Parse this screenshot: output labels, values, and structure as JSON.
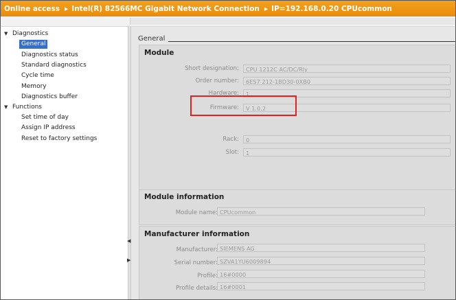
{
  "titlebar": {
    "online_access": "Online access",
    "sep1": "▸",
    "adapter": "Intel(R) 82566MC Gigabit Network Connection",
    "sep2": "▸",
    "ip_device": "IP=192.168.0.20 CPUcommon"
  },
  "tree": {
    "diagnostics": "Diagnostics",
    "items": [
      "General",
      "Diagnostics status",
      "Standard diagnostics",
      "Cycle time",
      "Memory",
      "Diagnostics buffer"
    ],
    "functions": "Functions",
    "function_items": [
      "Set time of day",
      "Assign IP address",
      "Reset to factory settings"
    ]
  },
  "main": {
    "section_title": "General",
    "module": {
      "title": "Module",
      "short_designation_label": "Short designation:",
      "short_designation_value": "CPU 1212C AC/DC/Rly",
      "order_number_label": "Order number:",
      "order_number_value": "6ES7 212-1BD30-0XB0",
      "hardware_label": "Hardware:",
      "hardware_value": "1",
      "firmware_label": "Firmware:",
      "firmware_value": "V 1.0.2",
      "rack_label": "Rack:",
      "rack_value": "0",
      "slot_label": "Slot:",
      "slot_value": "1"
    },
    "module_information": {
      "title": "Module information",
      "module_name_label": "Module name:",
      "module_name_value": "CPUcommon"
    },
    "manufacturer_information": {
      "title": "Manufacturer information",
      "manufacturer_label": "Manufacturer:",
      "manufacturer_value": "SIEMENS AG",
      "serial_number_label": "Serial number:",
      "serial_number_value": "SZVA1YU6009894",
      "profile_label": "Profile:",
      "profile_value": "16#0000",
      "profile_details_label": "Profile details:",
      "profile_details_value": "16#0001"
    }
  },
  "colors": {
    "titlebar": "#ee9412",
    "selection": "#3a6ec6",
    "highlight": "#e51f1f"
  }
}
